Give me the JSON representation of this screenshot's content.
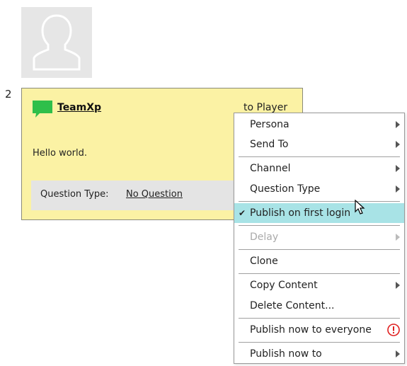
{
  "avatar": {
    "icon": "user-silhouette-icon"
  },
  "step": {
    "number": "2"
  },
  "card": {
    "sender": "TeamXp",
    "recipient": "to  Player",
    "message": "Hello world.",
    "question_type_label": "Question Type:",
    "question_type_value": "No Question",
    "colors": {
      "background": "#fbf2a4",
      "chat_icon": "#2fbf4a"
    }
  },
  "menu": {
    "items": [
      {
        "label": "Persona",
        "submenu": true
      },
      {
        "label": "Send To",
        "submenu": true
      },
      {
        "label": "Channel",
        "submenu": true
      },
      {
        "label": "Question Type",
        "submenu": true
      },
      {
        "label": "Publish on first login",
        "checked": true,
        "highlighted": true
      },
      {
        "label": "Delay",
        "submenu": true,
        "disabled": true
      },
      {
        "label": "Clone"
      },
      {
        "label": "Copy Content",
        "submenu": true
      },
      {
        "label": "Delete Content..."
      },
      {
        "label": "Publish now to everyone",
        "icon": "warning-icon",
        "icon_color": "#e02020"
      },
      {
        "label": "Publish now to",
        "submenu": true
      }
    ],
    "highlight_color": "#a8e3e6"
  }
}
